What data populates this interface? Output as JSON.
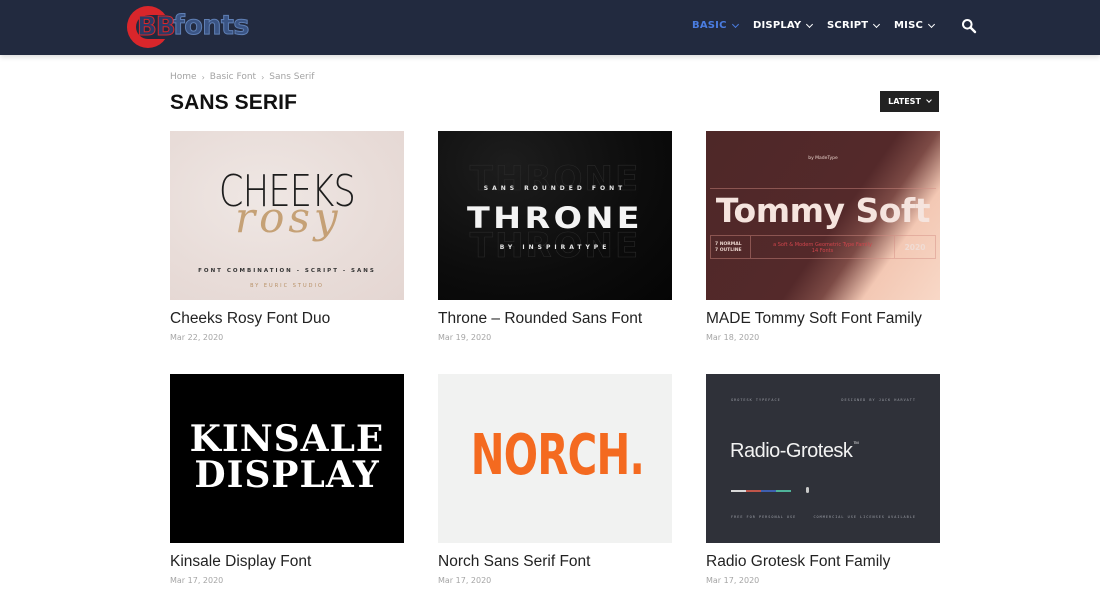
{
  "header": {
    "logo": {
      "part1": "BB",
      "part2": "fonts"
    },
    "nav": [
      {
        "label": "BASIC",
        "active": true
      },
      {
        "label": "DISPLAY",
        "active": false
      },
      {
        "label": "SCRIPT",
        "active": false
      },
      {
        "label": "MISC",
        "active": false
      }
    ],
    "search_icon": "search-icon"
  },
  "colors": {
    "header_bg": "#222a3f",
    "nav_active": "#4a7ce0",
    "logo_red": "#d9262b",
    "sort_button_bg": "#222222"
  },
  "breadcrumb": {
    "items": [
      "Home",
      "Basic Font",
      "Sans Serif"
    ],
    "separator": "›"
  },
  "page": {
    "title": "SANS SERIF",
    "sort_label": "LATEST"
  },
  "posts": [
    {
      "title": "Cheeks Rosy Font Duo",
      "date": "Mar 22, 2020",
      "thumb": {
        "big": "CHEEKS",
        "script": "rosy",
        "sub": "FONT COMBINATION - SCRIPT - SANS",
        "by": "BY EURIC STUDIO"
      }
    },
    {
      "title": "Throne – Rounded Sans Font",
      "date": "Mar 19, 2020",
      "thumb": {
        "small": "SANS ROUNDED FONT",
        "big": "THRONE",
        "by": "BY INSPIRATYPE"
      }
    },
    {
      "title": "MADE Tommy Soft Font Family",
      "date": "Mar 18, 2020",
      "thumb": {
        "by": "by MadeType",
        "big": "Tommy Soft",
        "left_line1": "7 NORMAL",
        "left_line2": "7 OUTLINE",
        "mid_line1": "a Soft & Modern Geometric Type Family",
        "mid_line2": "14 Fonts",
        "right": "2020"
      }
    },
    {
      "title": "Kinsale Display Font",
      "date": "Mar 17, 2020",
      "thumb": {
        "line1": "KINSALE",
        "line2": "DISPLAY"
      }
    },
    {
      "title": "Norch Sans Serif Font",
      "date": "Mar 17, 2020",
      "thumb": {
        "big": "NORCH."
      }
    },
    {
      "title": "Radio Grotesk Font Family",
      "date": "Mar 17, 2020",
      "thumb": {
        "big": "Radio-Grotesk",
        "tm": "TM",
        "top_left": "GROTESK TYPEFACE",
        "top_right": "DESIGNED BY JACK HARVATT",
        "bottom_left": "FREE FOR PERSONAL USE",
        "bottom_right": "COMMERCIAL USE LICENSES AVAILABLE",
        "bar_colors": [
          "#d8d8d8",
          "#c0554a",
          "#3e5fb0",
          "#4fb39a"
        ]
      }
    }
  ]
}
